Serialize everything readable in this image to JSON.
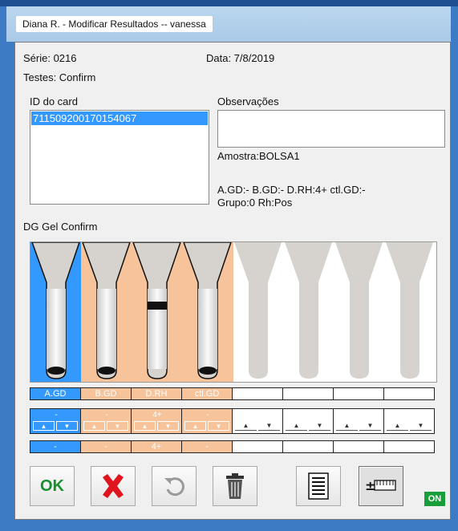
{
  "window": {
    "title": "Diana R. - Modificar Resultados -- vanessa"
  },
  "info": {
    "serie": "Série: 0216",
    "data": "Data: 7/8/2019",
    "testes": "Testes: Confirm"
  },
  "card": {
    "label": "ID do card",
    "items": [
      "711509200170154067"
    ]
  },
  "observacoes": {
    "label": "Observações",
    "value": "",
    "amostra": "Amostra:BOLSA1",
    "results_line1": "A.GD:-  B.GD:-  D.RH:4+  ctl.GD:-",
    "results_line2": "Grupo:0  Rh:Pos"
  },
  "gel": {
    "label": "DG Gel Confirm",
    "wells": [
      {
        "name": "A.GD",
        "result": "-",
        "bg": "#3399ff"
      },
      {
        "name": "B.GD",
        "result": "-",
        "bg": "#f7c39a"
      },
      {
        "name": "D.RH",
        "result": "4+",
        "bg": "#f7c39a"
      },
      {
        "name": "ctl.GD",
        "result": "-",
        "bg": "#f7c39a"
      },
      {
        "name": "",
        "result": "",
        "bg": "#ffffff"
      },
      {
        "name": "",
        "result": "",
        "bg": "#ffffff"
      },
      {
        "name": "",
        "result": "",
        "bg": "#ffffff"
      },
      {
        "name": "",
        "result": "",
        "bg": "#ffffff"
      }
    ]
  },
  "toolbar": {
    "ok_label": "OK",
    "icons": [
      "ok-icon",
      "cancel-x-icon",
      "undo-icon",
      "trash-icon",
      "report-icon",
      "ruler-plusminus-icon"
    ],
    "status_badge": "ON"
  },
  "colors": {
    "accent": "#3399ff",
    "positive": "#f7c39a",
    "ok_green": "#1a8f2e",
    "cancel_red": "#e0141e"
  }
}
